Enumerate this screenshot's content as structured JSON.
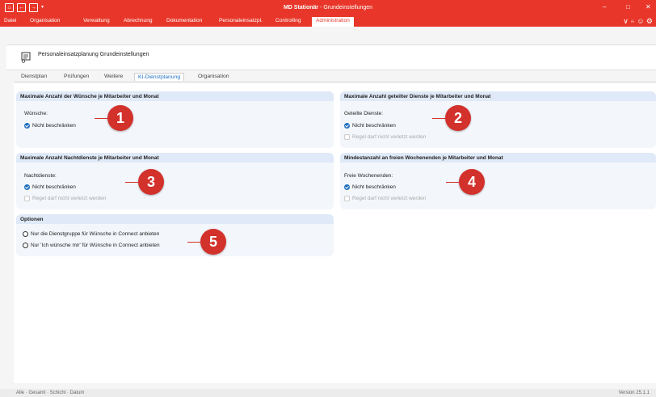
{
  "window": {
    "title_app": "MD Stationär",
    "title_rest": " - Grundeinstellungen",
    "controls": {
      "minimize": "–",
      "maximize": "□",
      "close": "✕"
    }
  },
  "quick_access": {
    "home": "⌂",
    "back": "←",
    "forward": "→",
    "dropdown": "▾"
  },
  "menu": {
    "items": [
      "Datei",
      "Organisation",
      "Verwaltung",
      "Abrechnung",
      "Dokumentation",
      "Personaleinsatzpl.",
      "Controlling",
      "Administration"
    ],
    "active": "Administration",
    "right_icons": "∨ ⍨ ☺ ⚙"
  },
  "header": {
    "title": "Personaleinsatzplanung Grundeinstellungen"
  },
  "tabs": [
    "Dienstplan",
    "Prüfungen",
    "Weitere",
    "KI-Dienstplanung",
    "Organisation"
  ],
  "active_tab": "KI-Dienstplanung",
  "panels": {
    "wishes": {
      "title": "Maximale Anzahl der Wünsche je Mitarbeiter und Monat",
      "label": "Wünsche:",
      "option1": "Nicht beschränken"
    },
    "split": {
      "title": "Maximale Anzahl geteilter Dienste je Mitarbeiter und Monat",
      "label": "Geteilte Dienste:",
      "option1": "Nicht beschränken",
      "option2": "Regel darf nicht verletzt werden"
    },
    "night": {
      "title": "Maximale Anzahl Nachtdienste je Mitarbeiter und Monat",
      "label": "Nachtdienste:",
      "option1": "Nicht beschränken",
      "option2": "Regel darf nicht verletzt werden"
    },
    "weekend": {
      "title": "Mindestanzahl an freien Wochenenden je Mitarbeiter und Monat",
      "label": "Freie Wochenenden:",
      "option1": "Nicht beschränken",
      "option2": "Regel darf nicht verletzt werden"
    },
    "options": {
      "title": "Optionen",
      "option1": "Nur die Dienstgruppe für Wünsche in Connect anbieten",
      "option2": "Nur 'Ich wünsche mir' für Wünsche in Connect anbieten"
    }
  },
  "markers": [
    "1",
    "2",
    "3",
    "4",
    "5"
  ],
  "statusbar": {
    "left": "Alle · Gesamt · Schicht · Datum",
    "right": "Version 25.1.1"
  },
  "colors": {
    "brand": "#e8372a",
    "accent": "#1e6fbf",
    "marker": "#d3312b",
    "panel_header": "#dfe9f7"
  }
}
